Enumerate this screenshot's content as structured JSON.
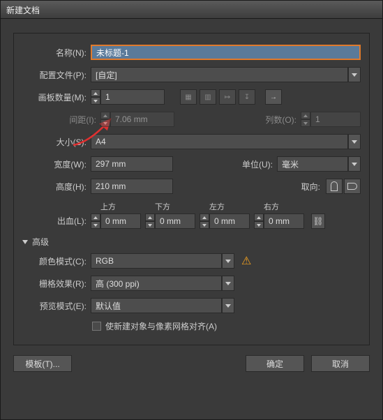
{
  "window": {
    "title": "新建文档"
  },
  "name": {
    "label": "名称(N):",
    "value": "未标题-1"
  },
  "profile": {
    "label": "配置文件(P):",
    "value": "[自定]"
  },
  "artboards": {
    "label": "画板数量(M):",
    "value": "1"
  },
  "spacing": {
    "label": "间距(I):",
    "value": "7.06 mm"
  },
  "cols": {
    "label": "列数(O):",
    "value": "1"
  },
  "size": {
    "label": "大小(S):",
    "value": "A4"
  },
  "width": {
    "label": "宽度(W):",
    "value": "297 mm"
  },
  "units": {
    "label": "单位(U):",
    "value": "毫米"
  },
  "height": {
    "label": "高度(H):",
    "value": "210 mm"
  },
  "orient": {
    "label": "取向:"
  },
  "bleed": {
    "label": "出血(L):",
    "top": {
      "head": "上方",
      "value": "0 mm"
    },
    "bottom": {
      "head": "下方",
      "value": "0 mm"
    },
    "left": {
      "head": "左方",
      "value": "0 mm"
    },
    "right": {
      "head": "右方",
      "value": "0 mm"
    }
  },
  "advanced": {
    "label": "高级"
  },
  "colormode": {
    "label": "颜色模式(C):",
    "value": "RGB"
  },
  "raster": {
    "label": "栅格效果(R):",
    "value": "高 (300 ppi)"
  },
  "preview": {
    "label": "预览模式(E):",
    "value": "默认值"
  },
  "align": {
    "label": "使新建对象与像素网格对齐(A)"
  },
  "buttons": {
    "templates": "模板(T)...",
    "ok": "确定",
    "cancel": "取消"
  }
}
